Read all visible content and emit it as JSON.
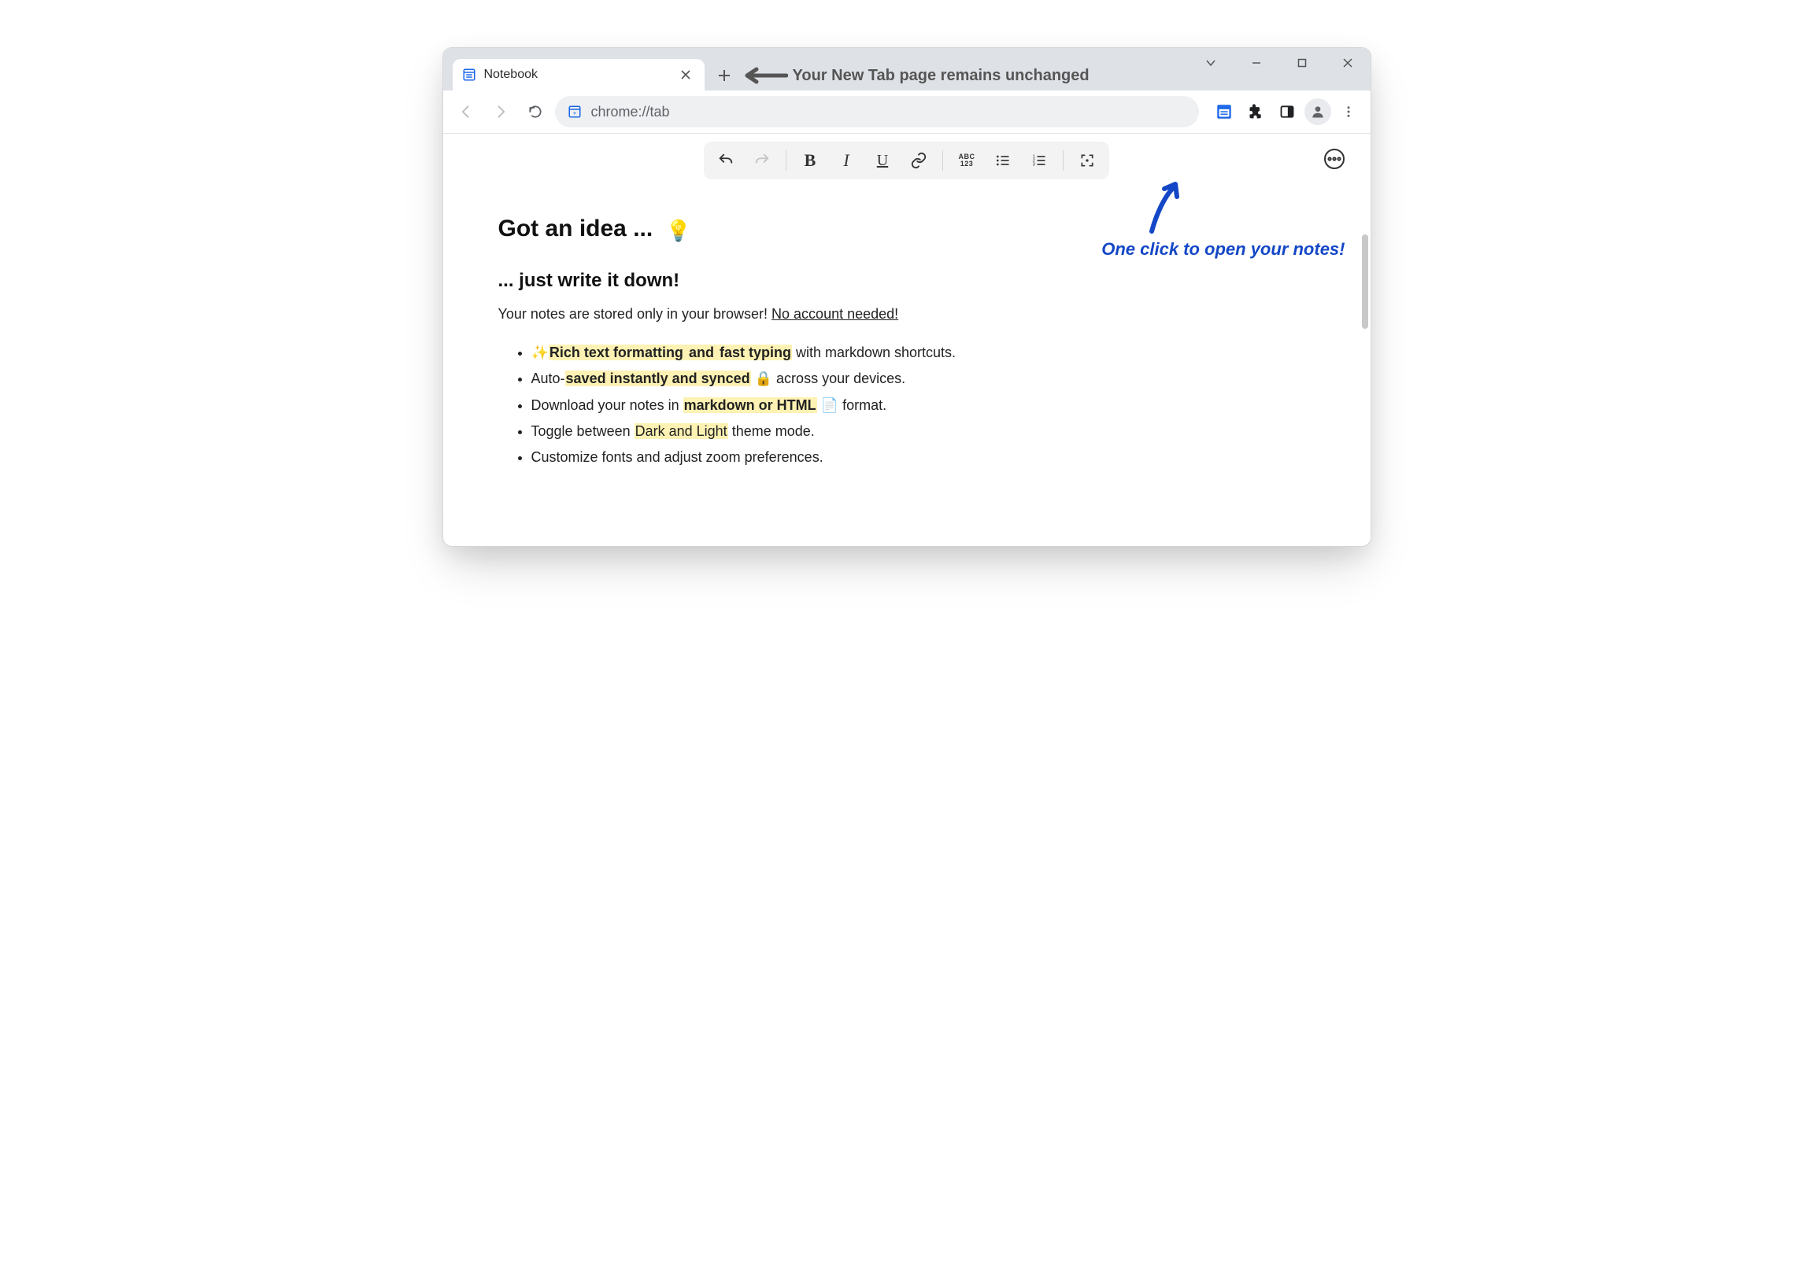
{
  "tab": {
    "title": "Notebook"
  },
  "titlebar_hint": "Your New Tab page remains unchanged",
  "omnibox_url": "chrome://tab",
  "annotation": "One click to open your notes!",
  "content": {
    "heading1_text": "Got an idea ...",
    "heading1_emoji": "💡",
    "heading2": "... just write it down!",
    "sub_pre": "Your notes are stored only in your browser! ",
    "sub_underlined": "No account needed!",
    "items": {
      "i0": {
        "sparkle": "✨",
        "hl1": "Rich text formatting",
        "mid": " and ",
        "hl2": "fast typing",
        "tail": " with markdown shortcuts."
      },
      "i1": {
        "pre": "Auto-",
        "hl": "saved instantly and synced",
        "lock": " 🔒 ",
        "tail": "across your devices."
      },
      "i2": {
        "pre": "Download your notes in ",
        "hl": "markdown or HTML",
        "doc": " 📄 ",
        "tail": "format."
      },
      "i3": {
        "pre": "Toggle between ",
        "hl": "Dark and Light",
        "tail": " theme mode."
      },
      "i4": {
        "text": "Customize fonts and adjust zoom preferences."
      }
    }
  }
}
